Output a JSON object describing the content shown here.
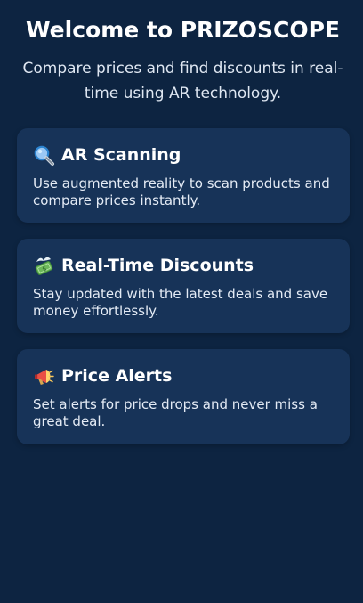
{
  "header": {
    "title": "Welcome to PRIZOSCOPE",
    "subtitle": "Compare prices and find discounts in real-time using AR technology."
  },
  "features": [
    {
      "icon": "magnifying-glass-icon",
      "title": "AR Scanning",
      "description": "Use augmented reality to scan products and compare prices instantly."
    },
    {
      "icon": "money-with-wings-icon",
      "title": "Real-Time Discounts",
      "description": "Stay updated with the latest deals and save money effortlessly."
    },
    {
      "icon": "megaphone-icon",
      "title": "Price Alerts",
      "description": "Set alerts for price drops and never miss a great deal."
    }
  ],
  "colors": {
    "background": "#0d2441",
    "card": "#173358",
    "text": "#ffffff",
    "muted_text": "#dfe7f2"
  }
}
